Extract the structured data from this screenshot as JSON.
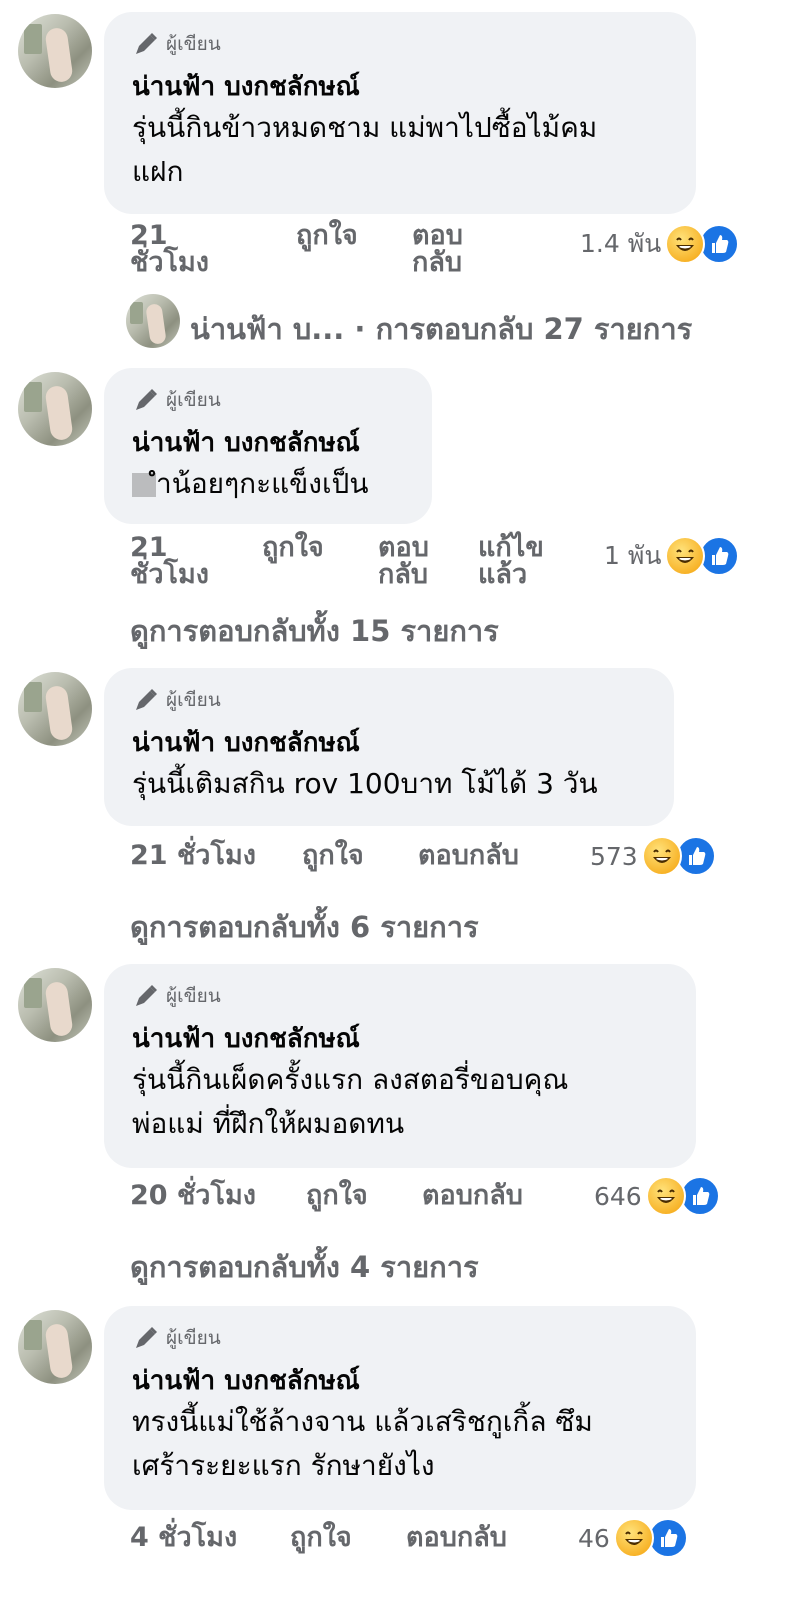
{
  "comments": [
    {
      "badge": "ผู้เขียน",
      "author": "น่านฟ้า บงกชลักษณ์",
      "text_lines": [
        "รุ่นนี้กินข้าวหมดชาม แม่พาไปซื้อไม้คม",
        "แฝก"
      ],
      "time": "21 ชั่วโมง",
      "like": "ถูกใจ",
      "reply": "ตอบกลับ",
      "reactions": "1.4 พัน"
    },
    {
      "badge": "ผู้เขียน",
      "author": "น่านฟ้า บงกชลักษณ์",
      "text_lines": [
        "ำน้อยๆกะแข็งเป็น"
      ],
      "time": "21 ชั่วโมง",
      "like": "ถูกใจ",
      "reply": "ตอบกลับ",
      "edited": "แก้ไขแล้ว",
      "reactions": "1 พัน",
      "view_replies": "ดูการตอบกลับทั้ง 15 รายการ"
    },
    {
      "badge": "ผู้เขียน",
      "author": "น่านฟ้า บงกชลักษณ์",
      "text_lines": [
        "รุ่นนี้เติมสกิน rov 100บาท โม้ได้ 3 วัน"
      ],
      "time": "21 ชั่วโมง",
      "like": "ถูกใจ",
      "reply": "ตอบกลับ",
      "reactions": "573",
      "view_replies": "ดูการตอบกลับทั้ง 6 รายการ"
    },
    {
      "badge": "ผู้เขียน",
      "author": "น่านฟ้า บงกชลักษณ์",
      "text_lines": [
        "รุ่นนี้กินเผ็ดครั้งแรก ลงสตอรี่ขอบคุณ",
        "พ่อแม่ ที่ฝึกให้ผมอดทน"
      ],
      "time": "20 ชั่วโมง",
      "like": "ถูกใจ",
      "reply": "ตอบกลับ",
      "reactions": "646",
      "view_replies": "ดูการตอบกลับทั้ง 4 รายการ"
    },
    {
      "badge": "ผู้เขียน",
      "author": "น่านฟ้า บงกชลักษณ์",
      "text_lines": [
        "ทรงนี้แม่ใช้ล้างจาน แล้วเสริชกูเกิ้ล ซึม",
        "เศร้าระยะแรก รักษายังไง"
      ],
      "time": "4 ชั่วโมง",
      "like": "ถูกใจ",
      "reply": "ตอบกลับ",
      "reactions": "46"
    }
  ],
  "reply_summary": {
    "name": "น่านฟ้า บ...",
    "separator": "·",
    "text": "การตอบกลับ 27 รายการ"
  },
  "icons": {
    "badge": "pen-icon",
    "reaction_1": "haha-icon",
    "reaction_2": "like-icon"
  },
  "colors": {
    "bubble": "#f0f2f5",
    "secondary_text": "#65676b",
    "like_blue": "#1b74e4",
    "haha_yellow": "#f7b125"
  }
}
